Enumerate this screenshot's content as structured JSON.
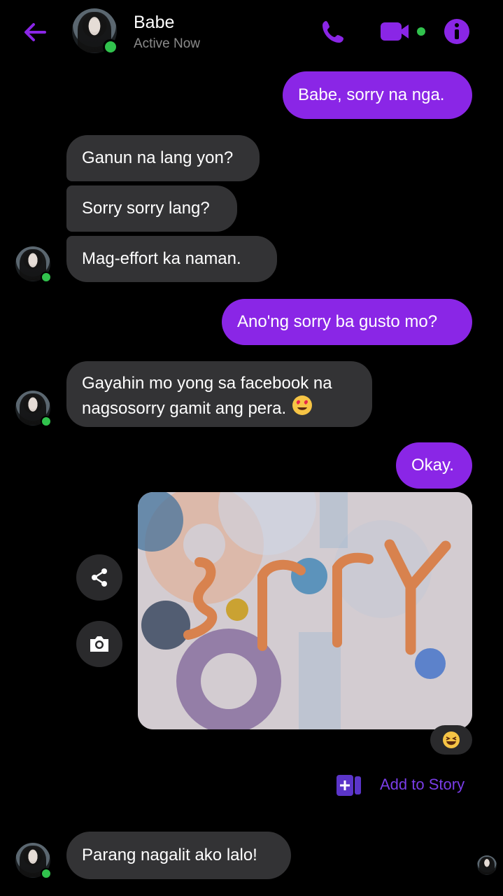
{
  "header": {
    "contact_name": "Babe",
    "status": "Active Now"
  },
  "messages": [
    {
      "from": "me",
      "text": "Babe, sorry na nga."
    },
    {
      "from": "them",
      "text": "Ganun na lang yon?"
    },
    {
      "from": "them",
      "text": "Sorry sorry lang?"
    },
    {
      "from": "them",
      "text": "Mag-effort ka naman."
    },
    {
      "from": "me",
      "text": "Ano'ng sorry ba gusto mo?"
    },
    {
      "from": "them",
      "line1": "Gayahin mo yong sa facebook na",
      "line2": "nagsosorry gamit ang pera."
    },
    {
      "from": "me",
      "text": "Okay."
    },
    {
      "from": "them",
      "text": "Parang nagalit ako lalo!"
    }
  ],
  "add_to_story": "Add to Story",
  "colors": {
    "accent": "#8a26e6",
    "incoming_bubble": "#333335",
    "online": "#31c24d",
    "background": "#000000"
  },
  "icons": [
    "back-arrow-icon",
    "phone-icon",
    "video-camera-icon",
    "info-icon",
    "share-icon",
    "camera-icon",
    "add-to-story-icon",
    "heart-eyes-emoji",
    "laughing-emoji"
  ]
}
